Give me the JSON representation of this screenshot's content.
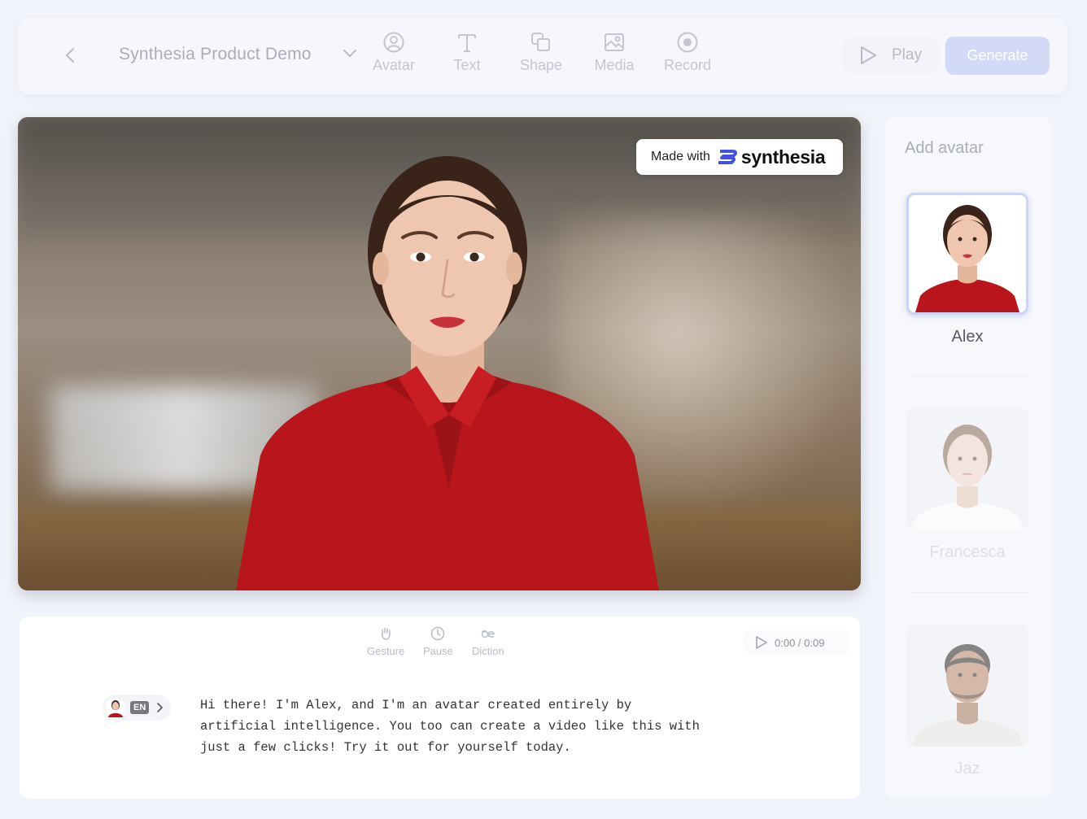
{
  "toolbar": {
    "project_title": "Synthesia Product Demo",
    "tools": [
      {
        "label": "Avatar",
        "icon": "avatar-icon"
      },
      {
        "label": "Text",
        "icon": "text-icon"
      },
      {
        "label": "Shape",
        "icon": "shape-icon"
      },
      {
        "label": "Media",
        "icon": "media-icon"
      },
      {
        "label": "Record",
        "icon": "record-icon"
      }
    ],
    "play_label": "Play",
    "generate_label": "Generate"
  },
  "video": {
    "badge_made_with": "Made with",
    "badge_brand": "synthesia"
  },
  "script": {
    "tools": [
      {
        "label": "Gesture",
        "icon": "gesture-icon"
      },
      {
        "label": "Pause",
        "icon": "clock-icon"
      },
      {
        "label": "Diction",
        "icon": "diction-icon"
      }
    ],
    "timer": "0:00 / 0:09",
    "language": "EN",
    "text": "Hi there! I'm Alex, and I'm an avatar created entirely by\nartificial intelligence. You too can create a video like this with\njust a few clicks! Try it out for yourself today."
  },
  "side_panel": {
    "title": "Add avatar",
    "avatars": [
      {
        "name": "Alex",
        "selected": true
      },
      {
        "name": "Francesca",
        "selected": false
      },
      {
        "name": "Jaz",
        "selected": false
      }
    ]
  },
  "colors": {
    "accent": "#4353e0",
    "generate_bg": "#d3daf8",
    "shirt_red": "#b8161c"
  }
}
